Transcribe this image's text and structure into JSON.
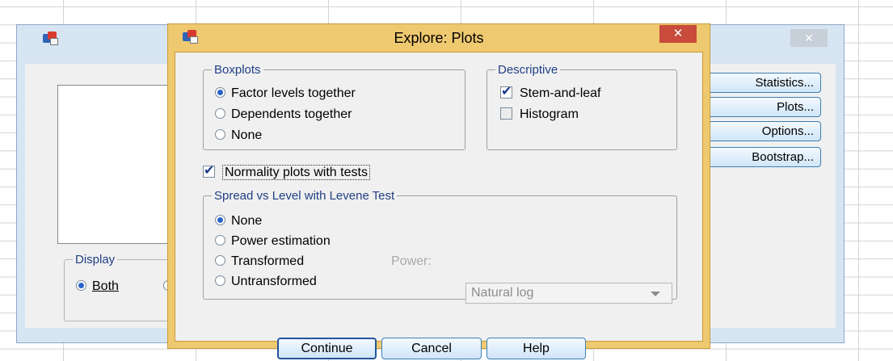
{
  "background_window": {
    "close_glyph": "✕",
    "display_group_title": "Display",
    "display_both_label": "Both",
    "buttons": [
      "Statistics...",
      "Plots...",
      "Options...",
      "Bootstrap..."
    ]
  },
  "dialog": {
    "title": "Explore: Plots",
    "close_glyph": "✕",
    "boxplots": {
      "title": "Boxplots",
      "options": [
        "Factor levels together",
        "Dependents together",
        "None"
      ],
      "selected": "Factor levels together"
    },
    "descriptive": {
      "title": "Descriptive",
      "stem_and_leaf": {
        "label": "Stem-and-leaf",
        "checked": true
      },
      "histogram": {
        "label": "Histogram",
        "checked": false
      }
    },
    "normality": {
      "label": "Normality plots with tests",
      "checked": true
    },
    "spread": {
      "title": "Spread vs Level with Levene Test",
      "options": [
        "None",
        "Power estimation",
        "Transformed",
        "Untransformed"
      ],
      "selected": "None",
      "power_label": "Power:",
      "power_value": "Natural log"
    },
    "buttons": {
      "continue": "Continue",
      "cancel": "Cancel",
      "help": "Help"
    }
  },
  "colors": {
    "dialog_frame": "#efc96f",
    "close_red": "#c84b3b",
    "accent": "#2a63c9"
  }
}
